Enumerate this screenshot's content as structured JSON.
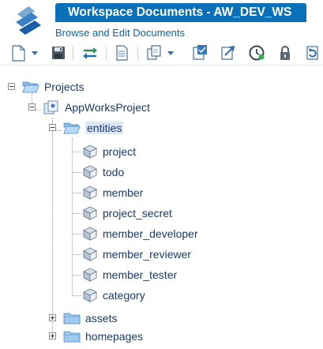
{
  "header": {
    "title": "Workspace Documents - AW_DEV_WS",
    "subtitle": "Browse and Edit Documents"
  },
  "toolbar": {
    "buttons": [
      {
        "name": "new-document",
        "icon": "new-document-icon",
        "has_dropdown": true
      },
      {
        "name": "save",
        "icon": "save-icon"
      },
      {
        "name": "sync",
        "icon": "sync-arrows-icon"
      },
      {
        "name": "properties",
        "icon": "properties-page-icon"
      },
      {
        "name": "copy",
        "icon": "copy-documents-icon",
        "has_dropdown": true
      },
      {
        "name": "publish",
        "icon": "publish-icon"
      },
      {
        "name": "export",
        "icon": "export-icon"
      },
      {
        "name": "history",
        "icon": "history-clock-icon"
      },
      {
        "name": "lock",
        "icon": "lock-icon"
      },
      {
        "name": "refresh",
        "icon": "refresh-icon"
      }
    ]
  },
  "tree": {
    "root": {
      "label": "Projects",
      "expanded": true
    },
    "project": {
      "label": "AppWorksProject",
      "expanded": true
    },
    "entities": {
      "label": "entities",
      "expanded": true,
      "selected": true,
      "items": [
        "project",
        "todo",
        "member",
        "project_secret",
        "member_developer",
        "member_reviewer",
        "member_tester",
        "category"
      ]
    },
    "assets": {
      "label": "assets",
      "expanded": false
    },
    "homepages": {
      "label": "homepages",
      "expanded": false
    }
  },
  "colors": {
    "title_bar": "#0a71b9",
    "subtitle": "#0d64a8",
    "selection": "#dbe7f4"
  }
}
